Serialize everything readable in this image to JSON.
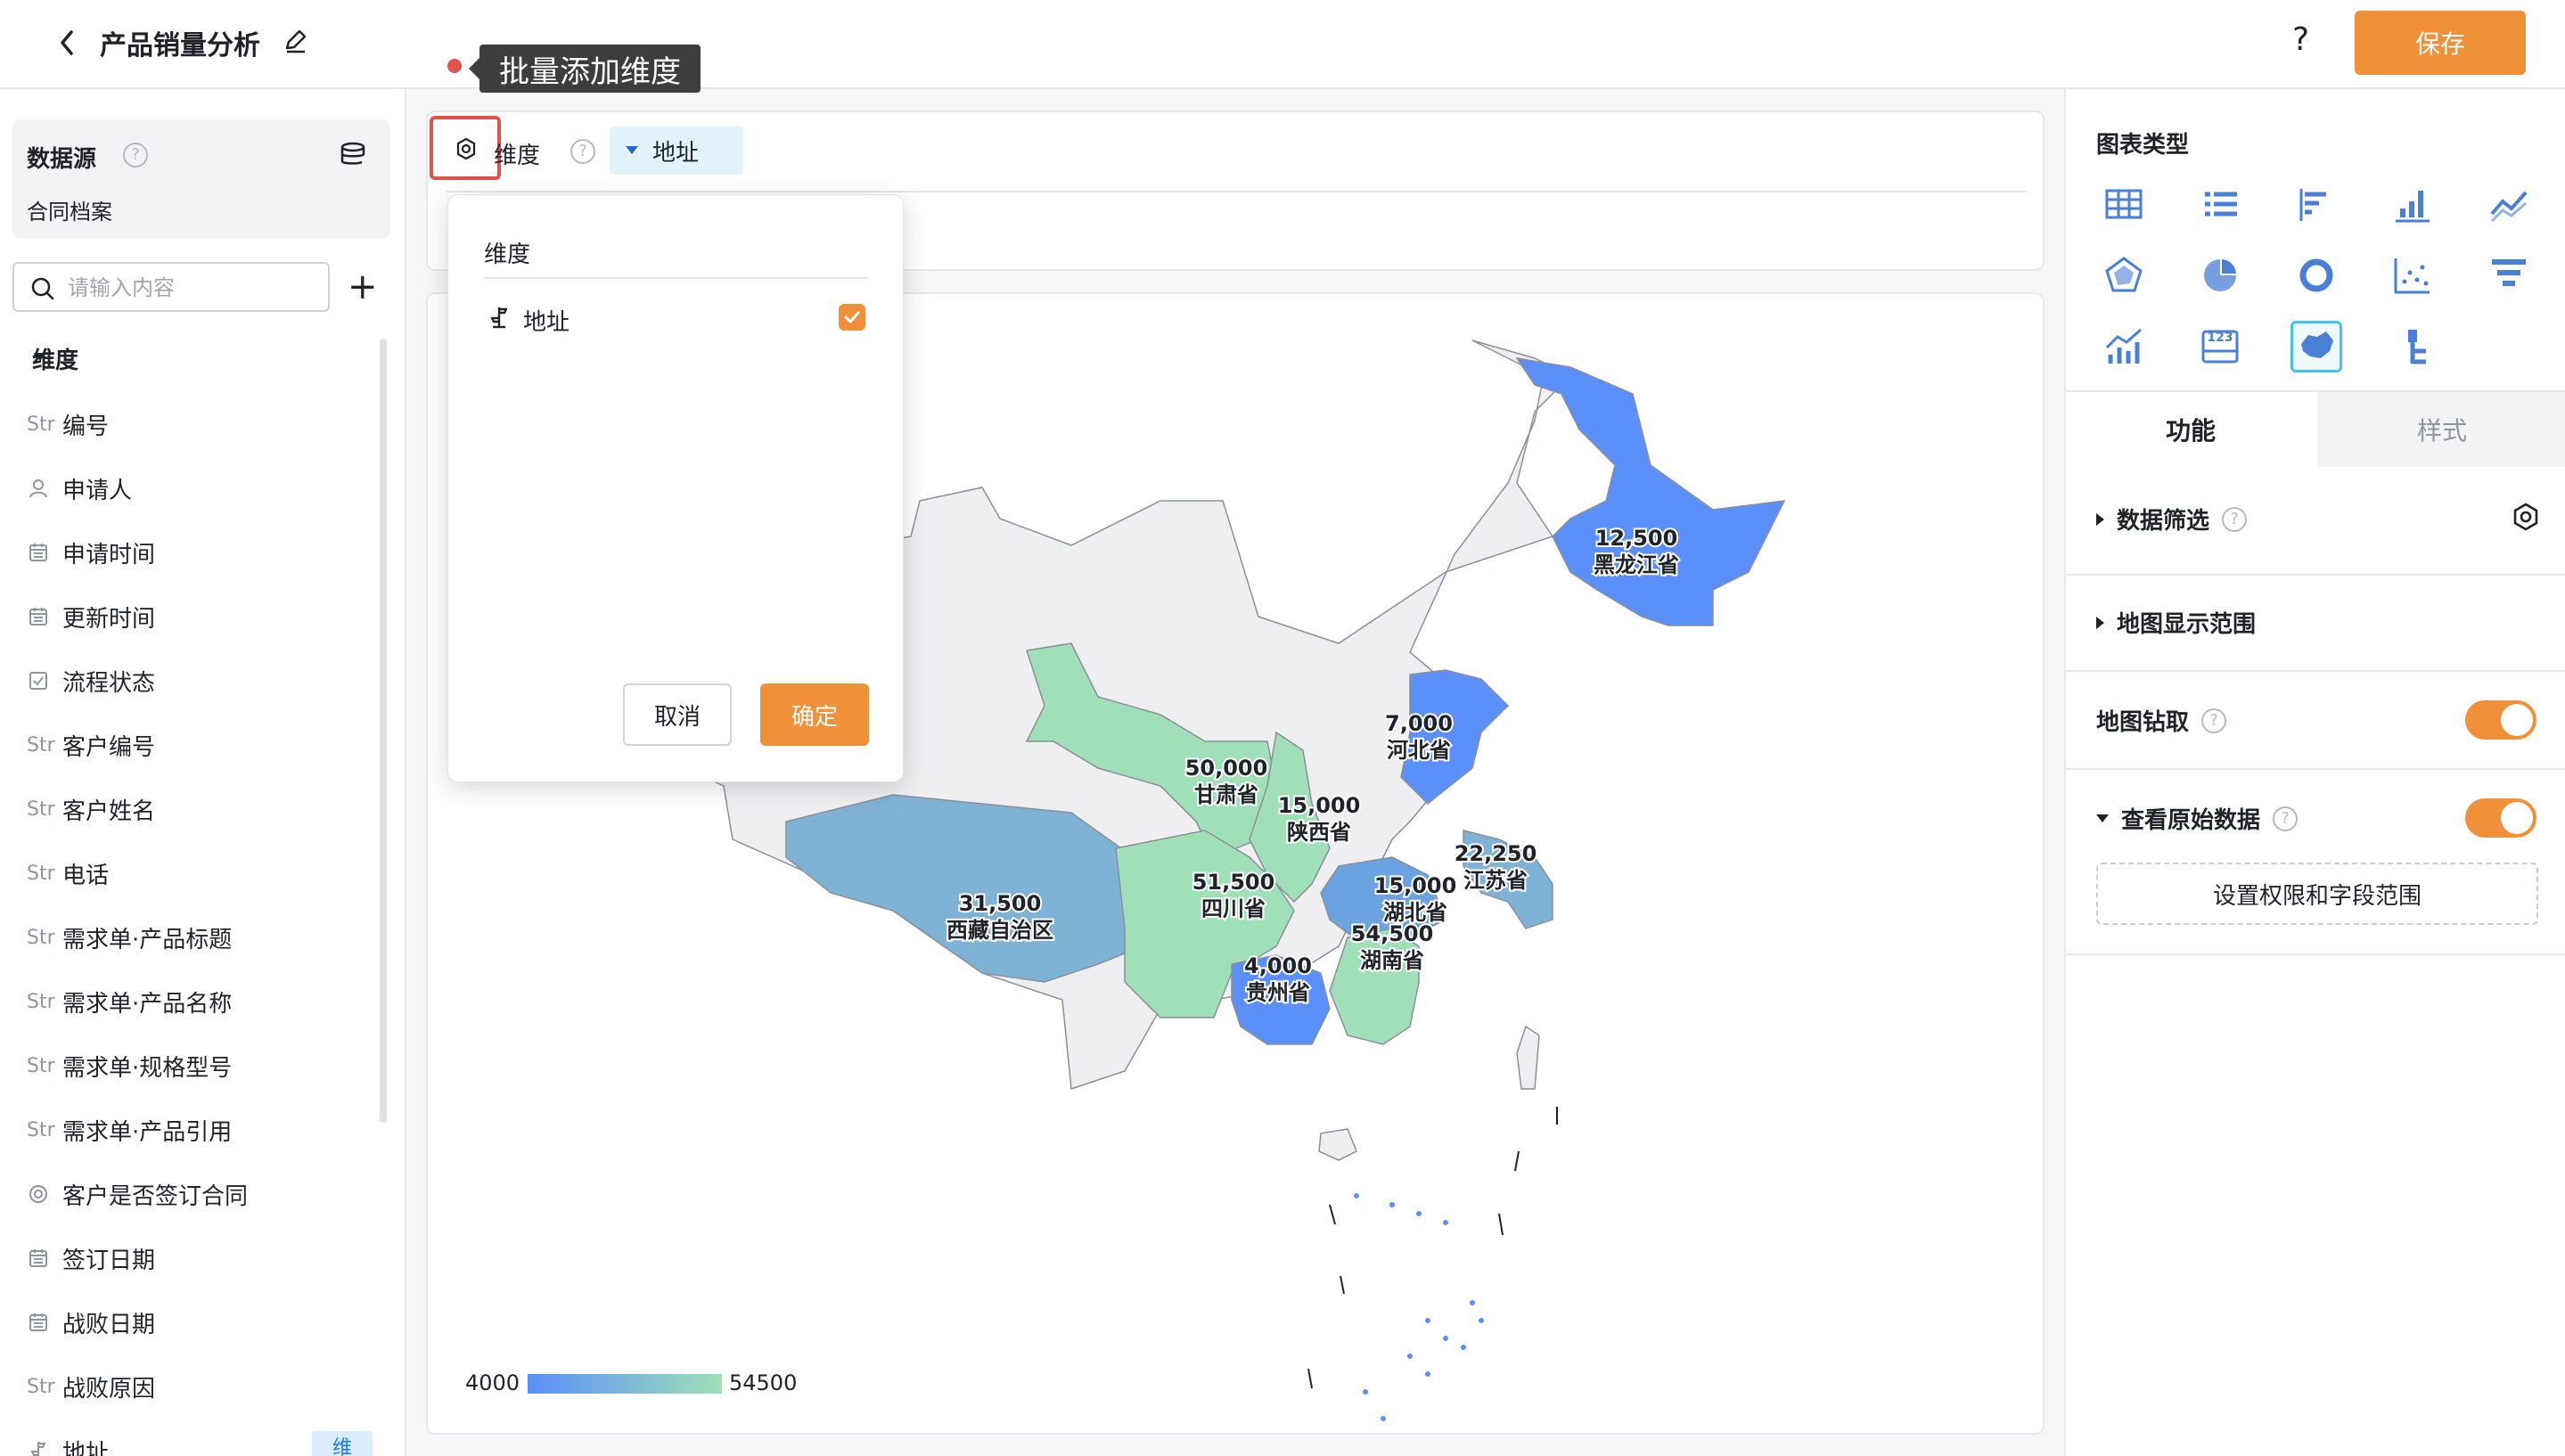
{
  "header": {
    "title": "产品销量分析",
    "save_label": "保存",
    "help_symbol": "?"
  },
  "tooltip": {
    "text": "批量添加维度"
  },
  "datasource": {
    "title": "数据源",
    "name": "合同档案",
    "help": "?"
  },
  "search": {
    "placeholder": "请输入内容",
    "add_symbol": "+"
  },
  "dimensions": {
    "header": "维度",
    "items": [
      {
        "type": "Str",
        "label": "编号"
      },
      {
        "type": "user-icon",
        "label": "申请人"
      },
      {
        "type": "calendar-icon",
        "label": "申请时间"
      },
      {
        "type": "calendar-icon",
        "label": "更新时间"
      },
      {
        "type": "checkbox-icon",
        "label": "流程状态"
      },
      {
        "type": "Str",
        "label": "客户编号"
      },
      {
        "type": "Str",
        "label": "客户姓名"
      },
      {
        "type": "Str",
        "label": "电话"
      },
      {
        "type": "Str",
        "label": "需求单·产品标题"
      },
      {
        "type": "Str",
        "label": "需求单·产品名称"
      },
      {
        "type": "Str",
        "label": "需求单·规格型号"
      },
      {
        "type": "Str",
        "label": "需求单·产品引用"
      },
      {
        "type": "radio-icon",
        "label": "客户是否签订合同"
      },
      {
        "type": "calendar-icon",
        "label": "签订日期"
      },
      {
        "type": "calendar-icon",
        "label": "战败日期"
      },
      {
        "type": "Str",
        "label": "战败原因"
      },
      {
        "type": "location-icon",
        "label": "地址"
      }
    ],
    "last_badge": "维"
  },
  "dim_bar": {
    "label": "维度",
    "help": "?",
    "chip": "地址"
  },
  "popover": {
    "title": "维度",
    "item_label": "地址",
    "item_checked": true,
    "cancel_label": "取消",
    "ok_label": "确定"
  },
  "map": {
    "legend_min": "4000",
    "legend_max": "54500",
    "colors": {
      "low": "#5b8ff9",
      "high": "#9fe0b8",
      "mid": "#7fb3d5",
      "base": "#efeff2"
    },
    "regions": [
      {
        "name": "黑龙江省",
        "value": "12,500"
      },
      {
        "name": "河北省",
        "value": "7,000"
      },
      {
        "name": "甘肃省",
        "value": "50,000"
      },
      {
        "name": "陕西省",
        "value": "15,000"
      },
      {
        "name": "江苏省",
        "value": "22,250"
      },
      {
        "name": "湖北省",
        "value": "15,000"
      },
      {
        "name": "西藏自治区",
        "value": "31,500"
      },
      {
        "name": "四川省",
        "value": "51,500"
      },
      {
        "name": "湖南省",
        "value": "54,500"
      },
      {
        "name": "贵州省",
        "value": "4,000"
      }
    ]
  },
  "right_panel": {
    "chart_type_title": "图表类型",
    "chart_icons": [
      "table-icon",
      "list-icon",
      "horizontal-bar-icon",
      "bar-chart-icon",
      "line-chart-icon",
      "radar-icon",
      "pie-icon",
      "donut-icon",
      "scatter-icon",
      "funnel-icon",
      "combo-chart-icon",
      "number-card-icon",
      "map-icon",
      "tree-icon"
    ],
    "number_card_text": "123",
    "tab_function": "功能",
    "tab_style": "样式",
    "data_filter": "数据筛选",
    "map_range": "地图显示范围",
    "map_drill": "地图钻取",
    "view_raw": "查看原始数据",
    "permissions_btn": "设置权限和字段范围",
    "help": "?"
  }
}
